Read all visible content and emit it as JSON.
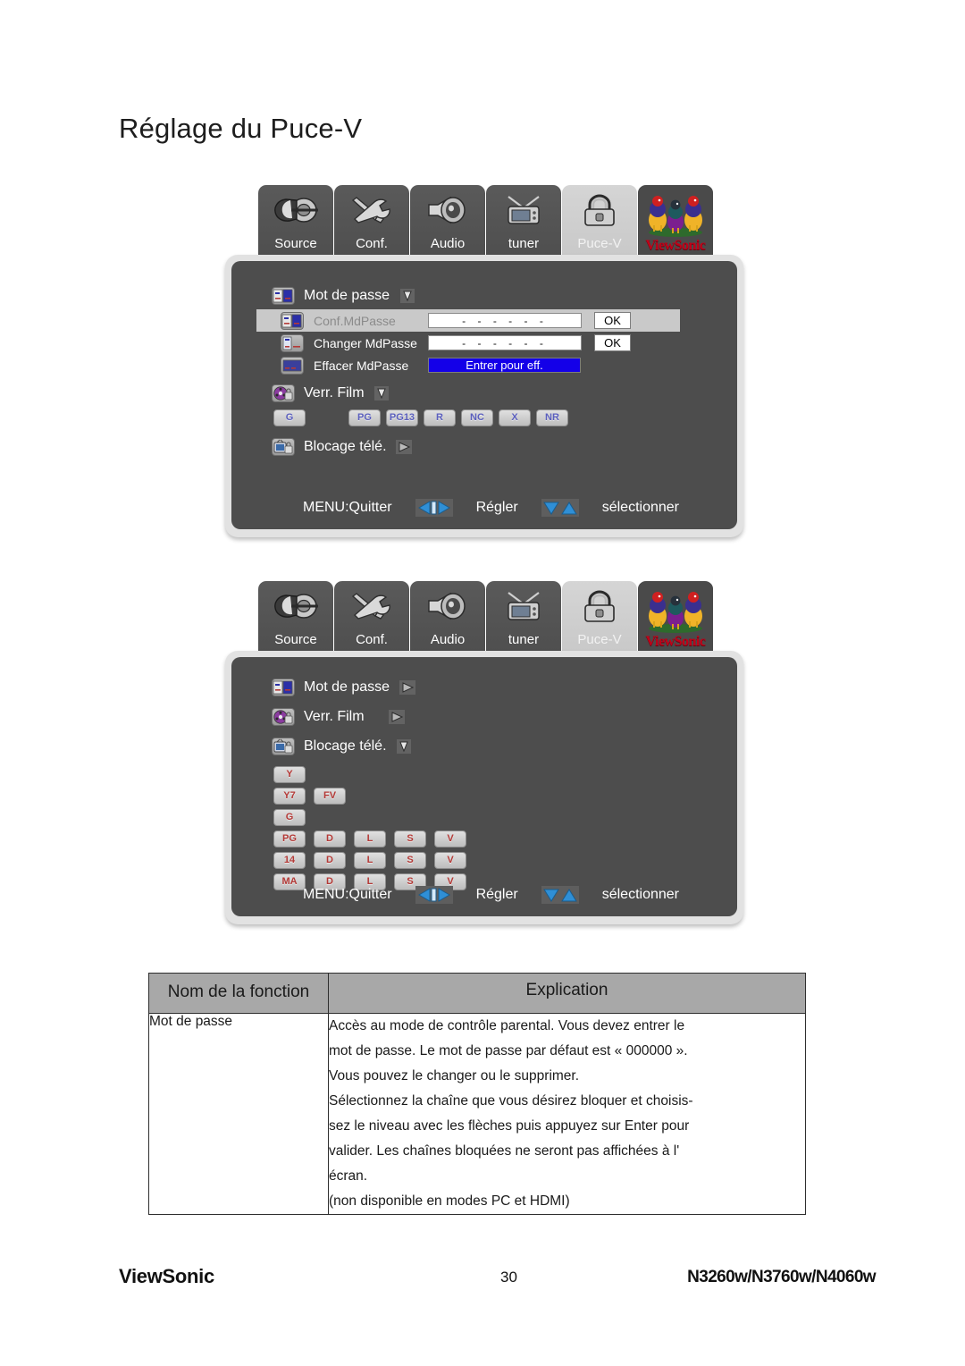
{
  "page": {
    "title": "Réglage du Puce-V",
    "footer": {
      "brand": "ViewSonic",
      "page_number": "30",
      "models": "N3260w/N3760w/N4060w"
    }
  },
  "osd_tabs": [
    {
      "label": "Source",
      "icon": "plug-icon",
      "selected": false
    },
    {
      "label": "Conf.",
      "icon": "tools-icon",
      "selected": false
    },
    {
      "label": "Audio",
      "icon": "speaker-icon",
      "selected": false
    },
    {
      "label": "tuner",
      "icon": "tv-antenna-icon",
      "selected": false
    },
    {
      "label": "Puce-V",
      "icon": "padlock-icon",
      "selected": true
    },
    {
      "label": "ViewSonic",
      "icon": "viewsonic-birds-logo",
      "selected": false
    }
  ],
  "panel1": {
    "rows": {
      "password": "Mot de passe",
      "movie_lock": "Verr. Film",
      "tv_lock": "Blocage télé."
    },
    "password_items": [
      {
        "label": "Conf.MdPasse",
        "value": "- - - - - -",
        "button": "OK",
        "highlighted": true
      },
      {
        "label": "Changer MdPasse",
        "value": "- - - - - -",
        "button": "OK",
        "highlighted": false
      },
      {
        "label": "Effacer MdPasse",
        "value": "Entrer pour eff.",
        "highlighted": false
      }
    ],
    "movie_ratings_left": [
      "G"
    ],
    "movie_ratings_right": [
      "PG",
      "PG13",
      "R",
      "NC",
      "X",
      "NR"
    ]
  },
  "panel2": {
    "rows": {
      "password": "Mot de passe",
      "movie_lock": "Verr. Film",
      "tv_lock": "Blocage télé."
    },
    "tv_grid": [
      [
        "Y"
      ],
      [
        "Y7",
        "FV"
      ],
      [
        "G"
      ],
      [
        "PG",
        "D",
        "L",
        "S",
        "V"
      ],
      [
        "14",
        "D",
        "L",
        "S",
        "V"
      ],
      [
        "MA",
        "D",
        "L",
        "S",
        "V"
      ]
    ]
  },
  "osd_footer": {
    "exit": "MENU:Quitter",
    "adjust": "Régler",
    "select": "sélectionner",
    "left_right_icon": "left-right-arrows-icon",
    "up_down_icon": "up-down-arrows-icon"
  },
  "table": {
    "headers": {
      "function": "Nom de la fonction",
      "explanation": "Explication"
    },
    "rows": [
      {
        "function": "Mot de passe",
        "lines": [
          "Accès au mode de contrôle parental. Vous devez entrer le",
          "mot de passe. Le mot de passe par défaut est « 000000 ».",
          "Vous pouvez le changer ou le supprimer.",
          "Sélectionnez la chaîne que vous désirez bloquer et choisis-",
          "sez le niveau avec les flèches puis appuyez sur Enter pour",
          "valider. Les chaînes bloquées ne seront pas affichées à l'",
          "écran.",
          "(non disponible en modes PC et HDMI)"
        ]
      }
    ]
  },
  "colors": {
    "osd_panel": "#4d4d4d",
    "osd_border": "#e2e2e2",
    "highlight_row": "#c9c9c9",
    "erase_bar": "#1400e8",
    "brand_red": "#c00018",
    "table_header": "#a8a8a8"
  }
}
